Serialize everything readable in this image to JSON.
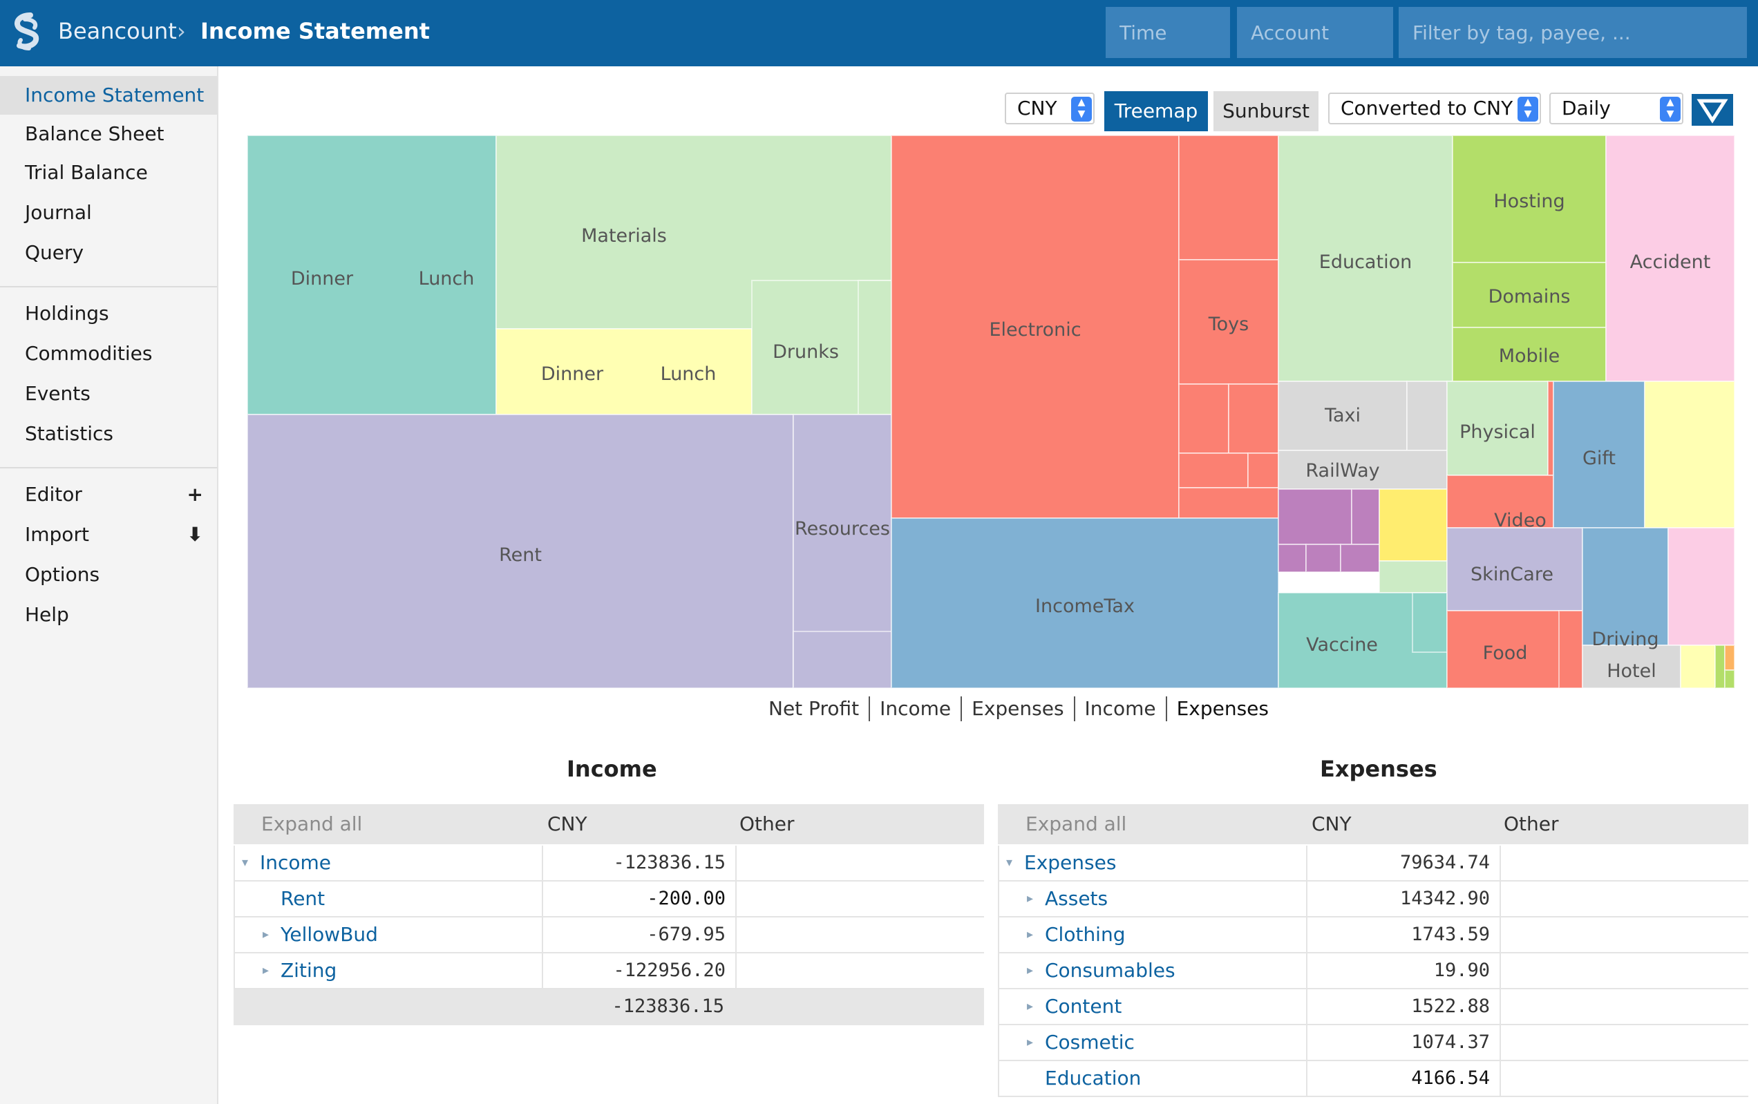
{
  "header": {
    "brand": "Beancount",
    "separator": "›",
    "title": "Income Statement",
    "time_placeholder": "Time",
    "account_placeholder": "Account",
    "filter_placeholder": "Filter by tag, payee, ..."
  },
  "sidebar": {
    "items": [
      {
        "label": "Income Statement",
        "active": true
      },
      {
        "label": "Balance Sheet"
      },
      {
        "label": "Trial Balance"
      },
      {
        "label": "Journal"
      },
      {
        "label": "Query"
      },
      {
        "label": "Holdings"
      },
      {
        "label": "Commodities"
      },
      {
        "label": "Events"
      },
      {
        "label": "Statistics"
      },
      {
        "label": "Editor",
        "action": "+"
      },
      {
        "label": "Import",
        "action": "⬇"
      },
      {
        "label": "Options"
      },
      {
        "label": "Help"
      }
    ]
  },
  "toolbar": {
    "currency": "CNY",
    "treemap_label": "Treemap",
    "sunburst_label": "Sunburst",
    "conversion": "Converted to CNY",
    "interval": "Daily",
    "filter_icon": "triangle-down-icon"
  },
  "chart_switch": [
    "Net Profit",
    "Income",
    "Expenses",
    "Income",
    "Expenses"
  ],
  "chart_data": {
    "type": "treemap",
    "labels": [
      "Dinner",
      "Lunch",
      "Materials",
      "Dinner",
      "Lunch",
      "Drunks",
      "Rent",
      "Resources",
      "Electronic",
      "Toys",
      "IncomeTax",
      "Education",
      "Hosting",
      "Domains",
      "Mobile",
      "Accident",
      "Taxi",
      "RailWay",
      "Physical",
      "Gift",
      "Video",
      "SkinCare",
      "Vaccine",
      "Food",
      "Driving",
      "Hotel"
    ],
    "colors": {
      "teal": "#8dd3c7",
      "lightgreen": "#ccebc5",
      "yellow": "#ffffb3",
      "lavender": "#bebada",
      "red": "#fb8072",
      "blue": "#80b1d3",
      "orange": "#fdb462",
      "lime": "#b3de69",
      "pink": "#fccde5",
      "grey": "#d9d9d9",
      "purple": "#bc80bd",
      "gold": "#ffed6f"
    }
  },
  "income": {
    "title": "Income",
    "expand_all": "Expand all",
    "col_currency": "CNY",
    "col_other": "Other",
    "rows": [
      {
        "name": "Income",
        "value": "-123836.15",
        "toggle": "▾"
      },
      {
        "name": "Rent",
        "value": "-200.00",
        "toggle": ""
      },
      {
        "name": "YellowBud",
        "value": "-679.95",
        "toggle": "▸"
      },
      {
        "name": "Ziting",
        "value": "-122956.20",
        "toggle": "▸"
      }
    ],
    "total": "-123836.15"
  },
  "expenses": {
    "title": "Expenses",
    "expand_all": "Expand all",
    "col_currency": "CNY",
    "col_other": "Other",
    "rows": [
      {
        "name": "Expenses",
        "value": "79634.74",
        "toggle": "▾"
      },
      {
        "name": "Assets",
        "value": "14342.90",
        "toggle": "▸"
      },
      {
        "name": "Clothing",
        "value": "1743.59",
        "toggle": "▸"
      },
      {
        "name": "Consumables",
        "value": "19.90",
        "toggle": "▸"
      },
      {
        "name": "Content",
        "value": "1522.88",
        "toggle": "▸"
      },
      {
        "name": "Cosmetic",
        "value": "1074.37",
        "toggle": "▸"
      },
      {
        "name": "Education",
        "value": "4166.54",
        "toggle": ""
      }
    ]
  }
}
